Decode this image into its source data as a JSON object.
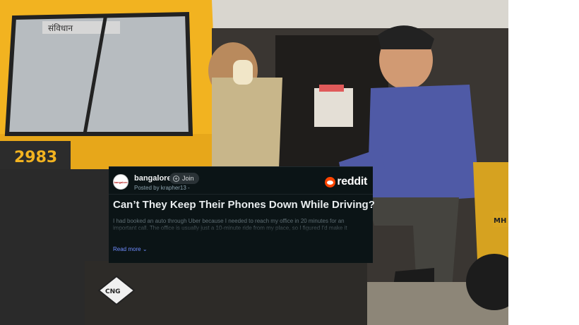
{
  "embed": {
    "community": "bangalore",
    "community_avatar_text": "bangalore",
    "join_label": "Join",
    "join_icon": "plus-circle-icon",
    "posted_by": "Posted by krapher13 -",
    "brand": "reddit",
    "brand_icon": "reddit-snoo-icon",
    "title": "Can’t They Keep Their Phones Down While Driving?",
    "body": "I had booked an auto through Uber because I needed to reach my office in 20 minutes for an important call. The office is usually just a 10-minute ride from my place, so I figured I'd make it",
    "read_more": "Read more",
    "read_more_icon": "chevron-down-icon"
  },
  "photo": {
    "subject": "auto rickshaw with passenger",
    "windshield_text": "संविधान",
    "plate_text": "2983",
    "side_badge": "CNG",
    "rear_badge": "MH"
  },
  "colors": {
    "card_background": "#0b1416",
    "reddit_orange": "#ff4500",
    "link_blue": "#6f8cff",
    "rickshaw_yellow": "#f2b320"
  }
}
